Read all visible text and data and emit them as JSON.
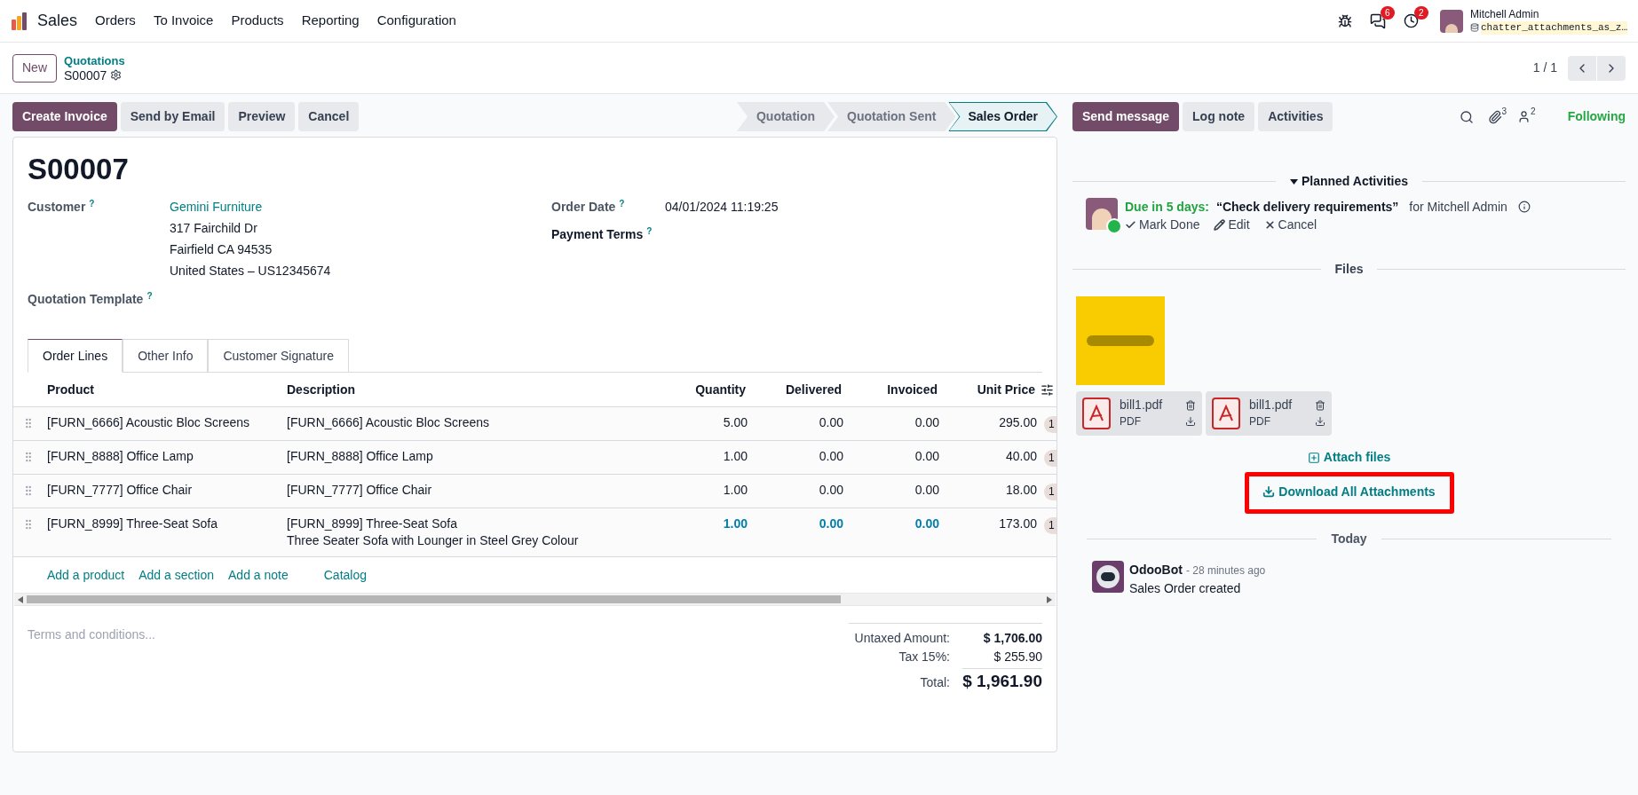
{
  "navbar": {
    "app_name": "Sales",
    "menu": [
      "Orders",
      "To Invoice",
      "Products",
      "Reporting",
      "Configuration"
    ],
    "messages_badge": "6",
    "activities_badge": "2",
    "user_name": "Mitchell Admin",
    "database": "chatter_attachments_as_z…"
  },
  "control_panel": {
    "new_button": "New",
    "breadcrumb_parent": "Quotations",
    "breadcrumb_current": "S00007",
    "pager": "1 / 1"
  },
  "actions": [
    {
      "label": "Create Invoice",
      "kind": "primary"
    },
    {
      "label": "Send by Email",
      "kind": "secondary"
    },
    {
      "label": "Preview",
      "kind": "secondary"
    },
    {
      "label": "Cancel",
      "kind": "secondary"
    }
  ],
  "status_steps": [
    {
      "label": "Quotation",
      "selected": false
    },
    {
      "label": "Quotation Sent",
      "selected": false
    },
    {
      "label": "Sales Order",
      "selected": true
    }
  ],
  "form": {
    "title": "S00007",
    "customer_label": "Customer",
    "help_mark": "?",
    "customer_name": "Gemini Furniture",
    "address_lines": [
      "317 Fairchild Dr",
      "Fairfield CA 94535",
      "United States – US12345674"
    ],
    "template_label": "Quotation Template",
    "order_date_label": "Order Date",
    "order_date": "04/01/2024 11:19:25",
    "payment_terms_label": "Payment Terms"
  },
  "tabs": [
    {
      "label": "Order Lines",
      "selected": true
    },
    {
      "label": "Other Info",
      "selected": false
    },
    {
      "label": "Customer Signature",
      "selected": false
    }
  ],
  "table": {
    "columns": [
      "Product",
      "Description",
      "Quantity",
      "Delivered",
      "Invoiced",
      "Unit Price"
    ],
    "rows": [
      {
        "product": "[FURN_6666] Acoustic Bloc Screens",
        "description": [
          "[FURN_6666] Acoustic Bloc Screens"
        ],
        "quantity": "5.00",
        "delivered": "0.00",
        "invoiced": "0.00",
        "unit_price": "295.00",
        "column_7": "1",
        "highlighted": false
      },
      {
        "product": "[FURN_8888] Office Lamp",
        "description": [
          "[FURN_8888] Office Lamp"
        ],
        "quantity": "1.00",
        "delivered": "0.00",
        "invoiced": "0.00",
        "unit_price": "40.00",
        "column_7": "1",
        "highlighted": false
      },
      {
        "product": "[FURN_7777] Office Chair",
        "description": [
          "[FURN_7777] Office Chair"
        ],
        "quantity": "1.00",
        "delivered": "0.00",
        "invoiced": "0.00",
        "unit_price": "18.00",
        "column_7": "1",
        "highlighted": false
      },
      {
        "product": "[FURN_8999] Three-Seat Sofa",
        "description": [
          "[FURN_8999] Three-Seat Sofa",
          "Three Seater Sofa with Lounger in Steel Grey Colour"
        ],
        "quantity": "1.00",
        "delivered": "0.00",
        "invoiced": "0.00",
        "unit_price": "173.00",
        "column_7": "1",
        "highlighted": true
      }
    ],
    "add_links": [
      "Add a product",
      "Add a section",
      "Add a note",
      "Catalog"
    ]
  },
  "terms_placeholder": "Terms and conditions...",
  "totals": [
    {
      "label": "Untaxed Amount:",
      "value": "$ 1,706.00",
      "kind": "subtotal"
    },
    {
      "label": "Tax 15%:",
      "value": "$ 255.90",
      "kind": "tax"
    },
    {
      "label": "Total:",
      "value": "$ 1,961.90",
      "kind": "total"
    }
  ],
  "chatter": {
    "buttons": [
      {
        "label": "Send message",
        "kind": "primary"
      },
      {
        "label": "Log note",
        "kind": "secondary"
      },
      {
        "label": "Activities",
        "kind": "secondary"
      }
    ],
    "attachment_count": "3",
    "follower_count": "2",
    "following": "Following",
    "planned_heading": "Planned Activities",
    "activity": {
      "due": "Due in 5 days:",
      "summary": "“Check delivery requirements”",
      "assignee": "for Mitchell Admin",
      "actions": [
        "Mark Done",
        "Edit",
        "Cancel"
      ]
    },
    "files_heading": "Files",
    "files": [
      {
        "name": "bill1.pdf",
        "type": "PDF"
      },
      {
        "name": "bill1.pdf",
        "type": "PDF"
      }
    ],
    "attach_link": "Attach files",
    "download_all": "Download All Attachments",
    "download_highlighted": true,
    "date_heading": "Today",
    "messages": [
      {
        "author": "OdooBot",
        "time": "- 28 minutes ago",
        "body": "Sales Order created"
      }
    ]
  }
}
